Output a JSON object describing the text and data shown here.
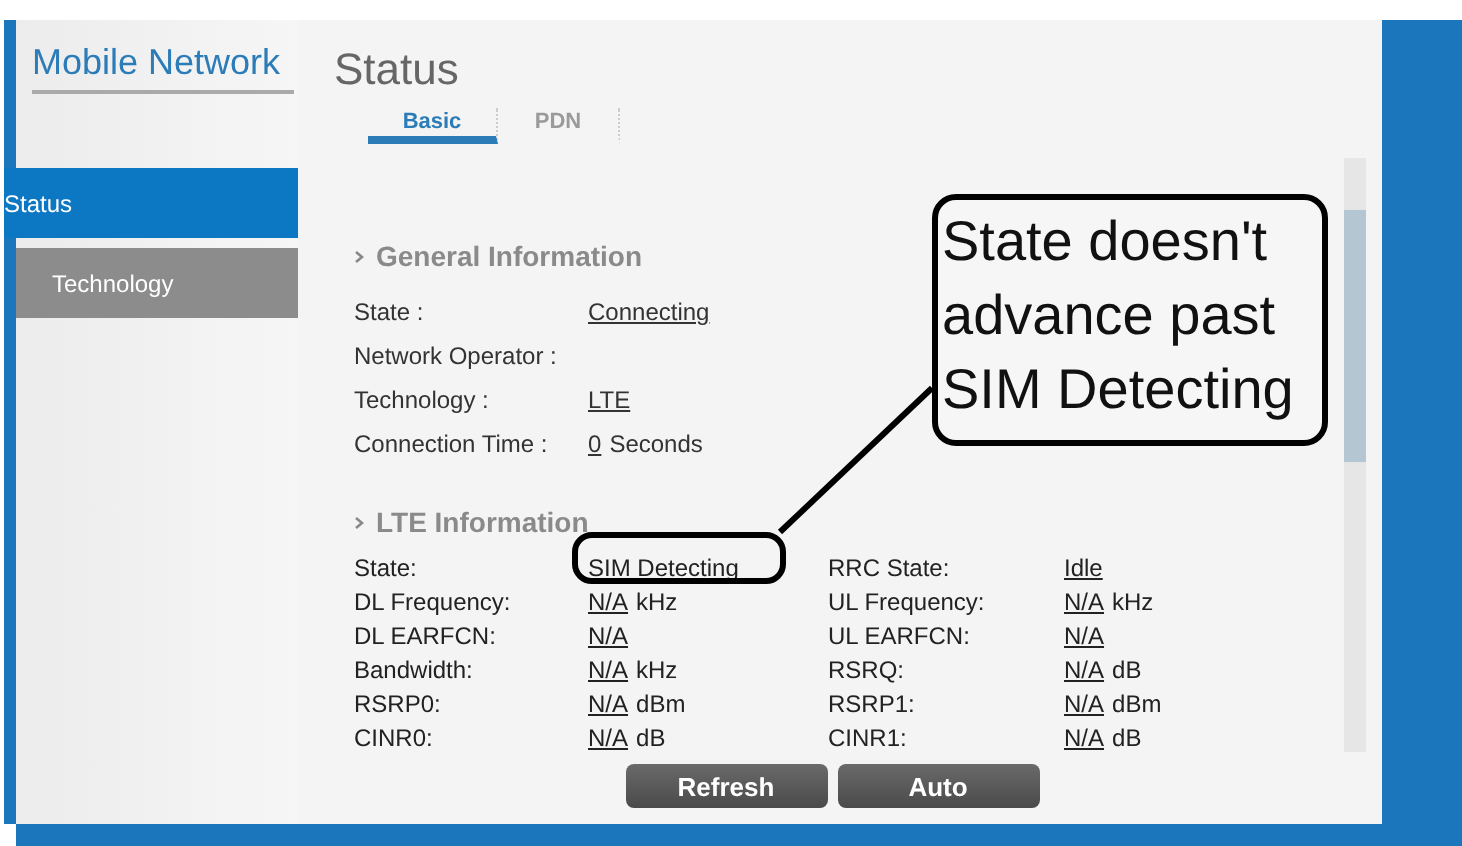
{
  "sidebar": {
    "title": "Mobile Network",
    "items": [
      {
        "label": "Status",
        "selected": true
      },
      {
        "label": "Technology",
        "selected": false
      }
    ]
  },
  "heading": "Status",
  "tabs": [
    {
      "label": "Basic",
      "selected": true
    },
    {
      "label": "PDN",
      "selected": false
    }
  ],
  "general": {
    "title": "General Information",
    "rows": [
      {
        "label": "State :",
        "value": "Connecting"
      },
      {
        "label": "Network Operator :"
      },
      {
        "label": "Technology :",
        "value": "LTE"
      },
      {
        "label": "Connection Time :",
        "value": "0",
        "unit": "Seconds"
      }
    ]
  },
  "lte": {
    "title": "LTE Information",
    "rows": [
      {
        "left": {
          "label": "State:",
          "value": "SIM Detecting"
        },
        "right": {
          "label": "RRC State:",
          "value": "Idle"
        }
      },
      {
        "left": {
          "label": "DL Frequency:",
          "value": "N/A",
          "unit": "kHz"
        },
        "right": {
          "label": "UL Frequency:",
          "value": "N/A",
          "unit": "kHz"
        }
      },
      {
        "left": {
          "label": "DL EARFCN:",
          "value": "N/A"
        },
        "right": {
          "label": "UL EARFCN:",
          "value": "N/A"
        }
      },
      {
        "left": {
          "label": "Bandwidth:",
          "value": "N/A",
          "unit": "kHz"
        },
        "right": {
          "label": "RSRQ:",
          "value": "N/A",
          "unit": "dB"
        }
      },
      {
        "left": {
          "label": "RSRP0:",
          "value": "N/A",
          "unit": "dBm"
        },
        "right": {
          "label": "RSRP1:",
          "value": "N/A",
          "unit": "dBm"
        }
      },
      {
        "left": {
          "label": "CINR0:",
          "value": "N/A",
          "unit": "dB"
        },
        "right": {
          "label": "CINR1:",
          "value": "N/A",
          "unit": "dB"
        }
      }
    ]
  },
  "buttons": [
    "Refresh",
    "Auto"
  ],
  "annotation": {
    "text": "State doesn't advance past SIM Detecting"
  }
}
